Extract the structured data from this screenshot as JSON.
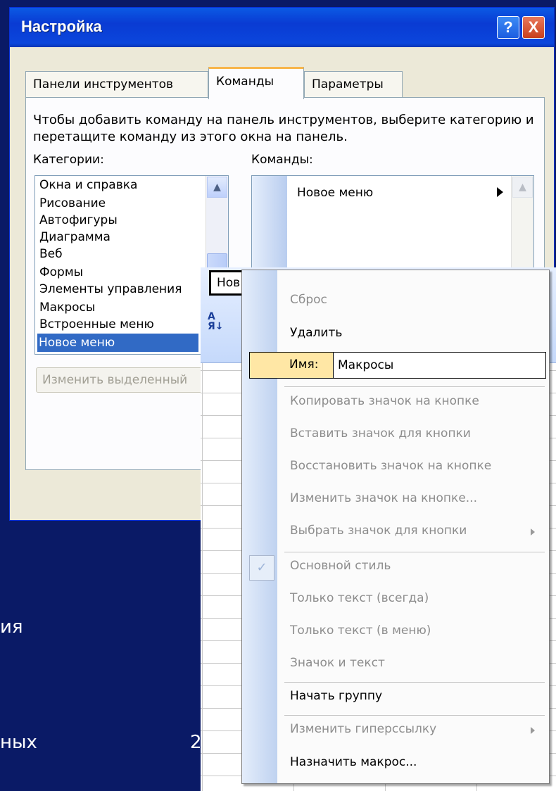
{
  "background": {
    "fragment1": "ия",
    "fragment2": "ных",
    "fragment3": "2"
  },
  "dialog": {
    "title": "Настройка",
    "help_label": "?",
    "close_label": "X",
    "tabs": [
      {
        "label": "Панели инструментов"
      },
      {
        "label": "Команды"
      },
      {
        "label": "Параметры"
      }
    ],
    "description": "Чтобы добавить команду на панель инструментов, выберите категорию и перетащите команду из этого окна на панель.",
    "categories_label": "Категории:",
    "commands_label": "Команды:",
    "categories": [
      "Окна и справка",
      "Рисование",
      "Автофигуры",
      "Диаграмма",
      "Веб",
      "Формы",
      "Элементы управления",
      "Макросы",
      "Встроенные меню",
      "Новое меню"
    ],
    "selected_category": "Новое меню",
    "command_item": "Новое меню",
    "modify_selection_button": "Изменить выделенный"
  },
  "toolbar": {
    "name_box_text": "Нов"
  },
  "context_menu": {
    "reset": "Сброс",
    "delete": "Удалить",
    "name_label": "Имя:",
    "name_value": "Макросы",
    "copy_icon": "Копировать значок на кнопке",
    "paste_icon": "Вставить значок для кнопки",
    "restore_icon": "Восстановить значок на кнопке",
    "edit_icon": "Изменить значок на кнопке...",
    "choose_icon": "Выбрать значок для кнопки",
    "default_style": "Основной стиль",
    "text_only_always": "Только текст (всегда)",
    "text_only_menu": "Только текст (в меню)",
    "image_and_text": "Значок и текст",
    "begin_group": "Начать группу",
    "edit_hyperlink": "Изменить гиперссылку",
    "assign_macro": "Назначить макрос..."
  }
}
